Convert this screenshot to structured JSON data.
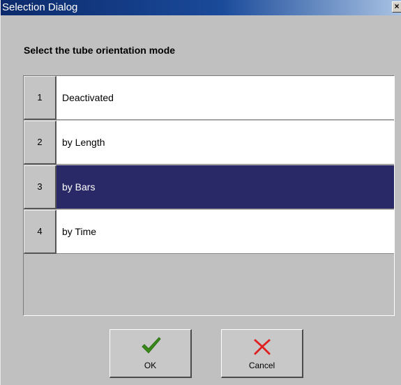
{
  "window": {
    "title": "Selection Dialog",
    "close_glyph": "×"
  },
  "prompt": "Select the tube orientation mode",
  "options": [
    {
      "number": "1",
      "label": "Deactivated",
      "selected": false
    },
    {
      "number": "2",
      "label": "by Length",
      "selected": false
    },
    {
      "number": "3",
      "label": "by Bars",
      "selected": true
    },
    {
      "number": "4",
      "label": "by Time",
      "selected": false
    }
  ],
  "buttons": {
    "ok_label": "OK",
    "cancel_label": "Cancel"
  },
  "icons": {
    "ok": "checkmark-icon",
    "cancel": "x-icon"
  },
  "colors": {
    "selection": "#292967",
    "ok_icon": "#3a8a1a",
    "cancel_icon": "#e02020"
  }
}
